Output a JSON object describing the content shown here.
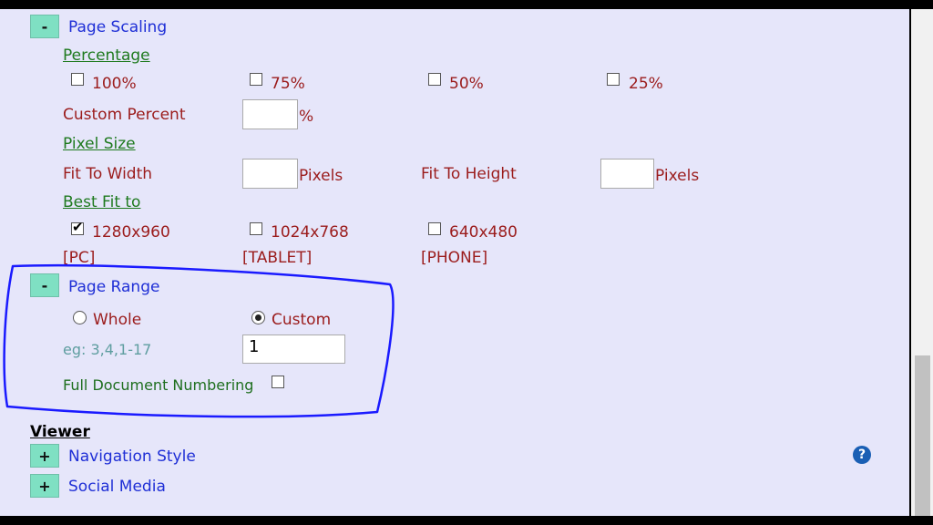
{
  "page_scaling": {
    "toggle": "-",
    "title": "Page Scaling",
    "percentage_label": "Percentage",
    "percent_options": [
      {
        "label": "100%",
        "checked": false
      },
      {
        "label": "75%",
        "checked": false
      },
      {
        "label": "50%",
        "checked": false
      },
      {
        "label": "25%",
        "checked": false
      }
    ],
    "custom_percent_label": "Custom Percent",
    "custom_percent_value": "",
    "percent_symbol": "%",
    "pixel_size_label": "Pixel Size",
    "fit_to_width_label": "Fit To Width",
    "fit_to_width_value": "",
    "fit_to_height_label": "Fit To Height",
    "fit_to_height_value": "",
    "pixels_unit": "Pixels",
    "best_fit_label": "Best Fit to",
    "best_fit_options": [
      {
        "label": "1280x960",
        "device": "[PC]",
        "checked": true
      },
      {
        "label": "1024x768",
        "device": "[TABLET]",
        "checked": false
      },
      {
        "label": "640x480",
        "device": "[PHONE]",
        "checked": false
      }
    ]
  },
  "page_range": {
    "toggle": "-",
    "title": "Page Range",
    "whole_label": "Whole",
    "custom_label": "Custom",
    "selected": "custom",
    "example_hint": "eg: 3,4,1-17",
    "range_value": "1",
    "full_numbering_label": "Full Document Numbering",
    "full_numbering_checked": false
  },
  "viewer": {
    "heading": "Viewer",
    "navigation_toggle": "+",
    "navigation_label": "Navigation Style",
    "social_toggle": "+",
    "social_label": "Social Media"
  },
  "help_icon": "?",
  "colors": {
    "panel_bg": "#e6e6fa",
    "toggle_bg": "#7fe0c3",
    "section_title": "#1f2fd6",
    "annotation": "#1a1aff"
  }
}
